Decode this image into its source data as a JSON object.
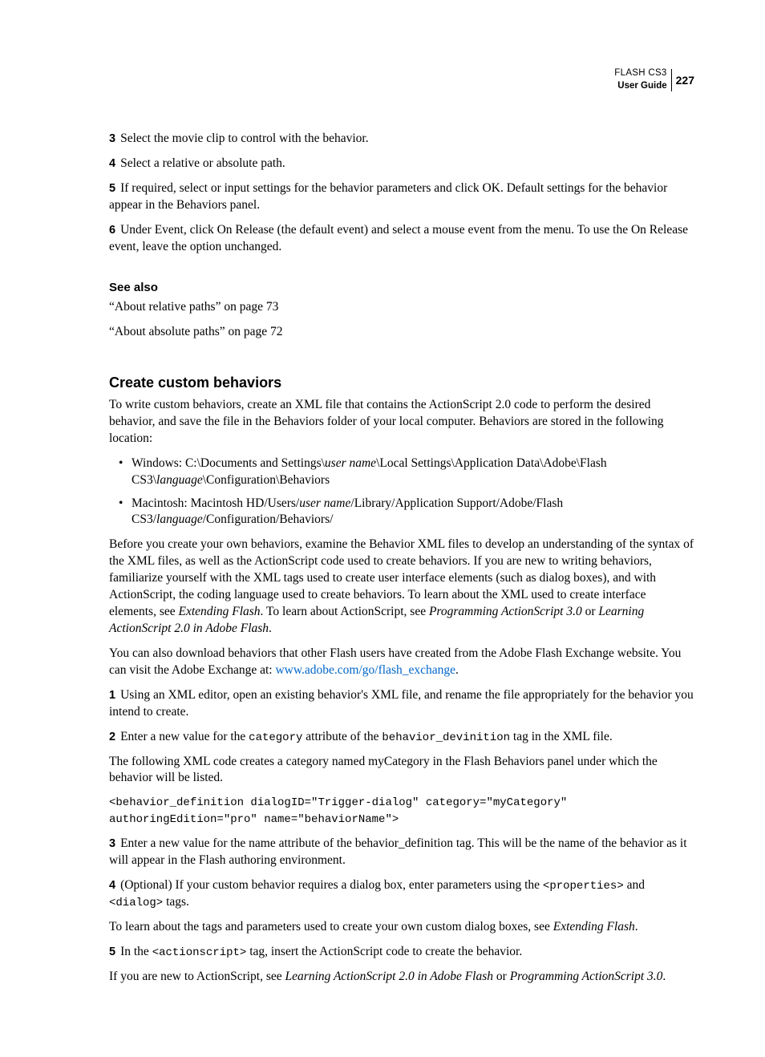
{
  "header": {
    "product": "FLASH CS3",
    "guide": "User Guide",
    "page_number": "227"
  },
  "steps_top": [
    {
      "num": "3",
      "text": "Select the movie clip to control with the behavior."
    },
    {
      "num": "4",
      "text": "Select a relative or absolute path."
    },
    {
      "num": "5",
      "text": "If required, select or input settings for the behavior parameters and click OK. Default settings for the behavior appear in the Behaviors panel."
    },
    {
      "num": "6",
      "text": "Under Event, click On Release (the default event) and select a mouse event from the menu. To use the On Release event, leave the option unchanged."
    }
  ],
  "see_also": {
    "heading": "See also",
    "items": [
      "“About relative paths” on page 73",
      "“About absolute paths” on page 72"
    ]
  },
  "section": {
    "heading": "Create custom behaviors",
    "intro": "To write custom behaviors, create an XML file that contains the ActionScript 2.0 code to perform the desired behavior, and save the file in the Behaviors folder of your local computer. Behaviors are stored in the following location:",
    "bullets": {
      "win": {
        "prefix": "Windows: C:\\Documents and Settings\\",
        "i1": "user name",
        "mid": "\\Local Settings\\Application Data\\Adobe\\Flash CS3\\",
        "i2": "language",
        "suffix": "\\Configuration\\Behaviors"
      },
      "mac": {
        "prefix": "Macintosh: Macintosh HD/Users/",
        "i1": "user name",
        "mid": "/Library/Application Support/Adobe/Flash CS3/",
        "i2": "language",
        "suffix": "/Configuration/Behaviors/"
      }
    },
    "p2": {
      "a": "Before you create your own behaviors, examine the Behavior XML files to develop an understanding of the syntax of the XML files, as well as the ActionScript code used to create behaviors. If you are new to writing behaviors, familiarize yourself with the XML tags used to create user interface elements (such as dialog boxes), and with ActionScript, the coding language used to create behaviors. To learn about the XML used to create interface elements, see ",
      "i1": "Extending Flash",
      "b": ". To learn about ActionScript, see ",
      "i2": "Programming ActionScript 3.0",
      "c": " or ",
      "i3": "Learning ActionScript 2.0 in Adobe Flash",
      "d": "."
    },
    "p3": {
      "a": "You can also download behaviors that other Flash users have created from the Adobe Flash Exchange website. You can visit the Adobe Exchange at: ",
      "link": "www.adobe.com/go/flash_exchange",
      "b": "."
    },
    "step1": {
      "num": "1",
      "text": "Using an XML editor, open an existing behavior's XML file, and rename the file appropriately for the behavior you intend to create."
    },
    "step2": {
      "num": "2",
      "a": "Enter a new value for the ",
      "m1": "category",
      "b": " attribute of the ",
      "m2": "behavior_devinition",
      "c": " tag in the XML file."
    },
    "p4": "The following XML code creates a category named myCategory in the Flash Behaviors panel under which the behavior will be listed.",
    "code": "<behavior_definition dialogID=\"Trigger-dialog\" category=\"myCategory\"\nauthoringEdition=\"pro\" name=\"behaviorName\">",
    "step3": {
      "num": "3",
      "text": "Enter a new value for the name attribute of the behavior_definition tag. This will be the name of the behavior as it will appear in the Flash authoring environment."
    },
    "step4": {
      "num": "4",
      "a": "(Optional) If your custom behavior requires a dialog box, enter parameters using the ",
      "m1": "<properties>",
      "b": " and ",
      "m2": "<dialog>",
      "c": " tags."
    },
    "p5": {
      "a": "To learn about the tags and parameters used to create your own custom dialog boxes, see ",
      "i1": "Extending Flash",
      "b": "."
    },
    "step5": {
      "num": "5",
      "a": "In the ",
      "m1": "<actionscript>",
      "b": " tag, insert the ActionScript code to create the behavior."
    },
    "p6": {
      "a": "If you are new to ActionScript, see ",
      "i1": "Learning ActionScript 2.0 in Adobe Flash",
      "b": " or ",
      "i2": "Programming ActionScript 3.0",
      "c": "."
    }
  }
}
